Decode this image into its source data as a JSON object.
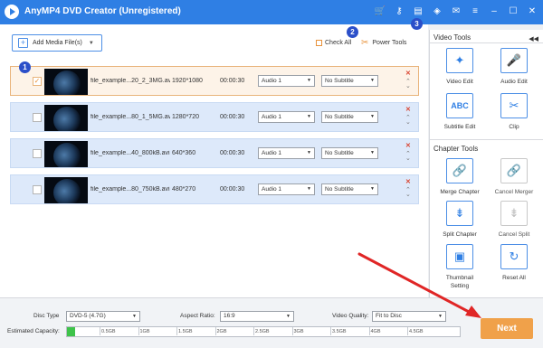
{
  "app": {
    "title": "AnyMP4 DVD Creator (Unregistered)"
  },
  "titlebar_icons": [
    {
      "name": "cart-icon",
      "glyph": "🛒"
    },
    {
      "name": "key-icon",
      "glyph": "⚷"
    },
    {
      "name": "save-icon",
      "glyph": "▤"
    },
    {
      "name": "share-icon",
      "glyph": "◈"
    },
    {
      "name": "feedback-icon",
      "glyph": "✉"
    },
    {
      "name": "menu-icon",
      "glyph": "≡"
    },
    {
      "name": "minimize-icon",
      "glyph": "–"
    },
    {
      "name": "maximize-icon",
      "glyph": "☐"
    },
    {
      "name": "close-icon",
      "glyph": "✕"
    }
  ],
  "toolbar": {
    "add_media_label": "Add Media File(s)",
    "check_all_label": "Check All",
    "power_tools_label": "Power Tools"
  },
  "badges": [
    "1",
    "2",
    "3"
  ],
  "files": [
    {
      "name": "file_example...20_2_3MG.avi",
      "resolution": "1920*1080",
      "duration": "00:00:30",
      "audio": "Audio 1",
      "subtitle": "No Subtitle",
      "checked": true
    },
    {
      "name": "file_example...80_1_5MG.avi",
      "resolution": "1280*720",
      "duration": "00:00:30",
      "audio": "Audio 1",
      "subtitle": "No Subtitle",
      "checked": false
    },
    {
      "name": "file_example...40_800kB.avi",
      "resolution": "640*360",
      "duration": "00:00:30",
      "audio": "Audio 1",
      "subtitle": "No Subtitle",
      "checked": false
    },
    {
      "name": "file_example...80_750kB.avi",
      "resolution": "480*270",
      "duration": "00:00:30",
      "audio": "Audio 1",
      "subtitle": "No Subtitle",
      "checked": false
    }
  ],
  "video_tools": {
    "heading": "Video Tools",
    "tools": [
      {
        "label": "Video Edit",
        "icon": "magic-wand-icon",
        "glyph": "✦"
      },
      {
        "label": "Audio Edit",
        "icon": "microphone-icon",
        "glyph": "🎤"
      },
      {
        "label": "Subtitle Edit",
        "icon": "abc-icon",
        "glyph": "ABC"
      },
      {
        "label": "Clip",
        "icon": "scissors-icon",
        "glyph": "✂"
      }
    ]
  },
  "chapter_tools": {
    "heading": "Chapter Tools",
    "tools": [
      {
        "label": "Merge Chapter",
        "icon": "link-icon",
        "glyph": "🔗"
      },
      {
        "label": "Cancel Merger",
        "icon": "broken-link-icon",
        "glyph": "🔗"
      },
      {
        "label": "Split Chapter",
        "icon": "split-icon",
        "glyph": "⇟"
      },
      {
        "label": "Cancel Split",
        "icon": "cancel-split-icon",
        "glyph": "⇟"
      },
      {
        "label": "Thumbnail Setting",
        "icon": "thumbnail-icon",
        "glyph": "▣"
      },
      {
        "label": "Reset All",
        "icon": "reset-icon",
        "glyph": "↻"
      }
    ]
  },
  "bottom": {
    "disc_type_label": "Disc Type",
    "disc_type_value": "DVD-5 (4.7G)",
    "aspect_ratio_label": "Aspect Ratio:",
    "aspect_ratio_value": "16:9",
    "video_quality_label": "Video Quality:",
    "video_quality_value": "Fit to Disc",
    "estimated_capacity_label": "Estimated Capacity:",
    "capacity_ticks": [
      "0.5GB",
      "1GB",
      "1.5GB",
      "2GB",
      "2.5GB",
      "3GB",
      "3.5GB",
      "4GB",
      "4.5GB"
    ],
    "capacity_used_fraction": 0.02,
    "next_label": "Next"
  },
  "colors": {
    "titlebar": "#2f7fe4",
    "accent_orange": "#f0a14a",
    "badge": "#2b4fc9",
    "arrow": "#e02626"
  }
}
